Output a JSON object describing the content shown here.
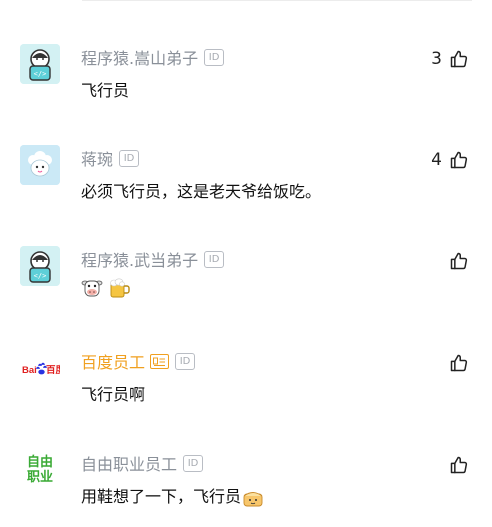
{
  "comments": [
    {
      "avatar": "programmer-ape-icon",
      "username": "程序猿.嵩山弟子",
      "id_label": "ID",
      "text": "飞行员",
      "likes": "3"
    },
    {
      "avatar": "sheep-icon",
      "username": "蒋琬",
      "id_label": "ID",
      "text": "必须飞行员，这是老天爷给饭吃。",
      "likes": "4"
    },
    {
      "avatar": "programmer-ape-icon",
      "username": "程序猿.武当弟子",
      "id_label": "ID",
      "text": "",
      "emojis": [
        "cow-face-emoji",
        "beer-mug-emoji"
      ],
      "likes": ""
    },
    {
      "avatar": "baidu-logo",
      "avatar_text": "Bai百度",
      "username": "百度员工",
      "id_label": "ID",
      "text": "飞行员啊",
      "likes": ""
    },
    {
      "avatar": "freelancer-logo",
      "avatar_text_line1": "自由",
      "avatar_text_line2": "职业",
      "username": "自由职业员工",
      "id_label": "ID",
      "text": "用鞋想了一下，飞行员",
      "emojis": [
        "pie-emoji"
      ],
      "likes": ""
    }
  ],
  "colors": {
    "username": "#8a9099",
    "employee_gold": "#f0a020",
    "freelancer_green": "#3aaa35",
    "baidu_blue": "#2932e1",
    "baidu_red": "#e02020"
  }
}
